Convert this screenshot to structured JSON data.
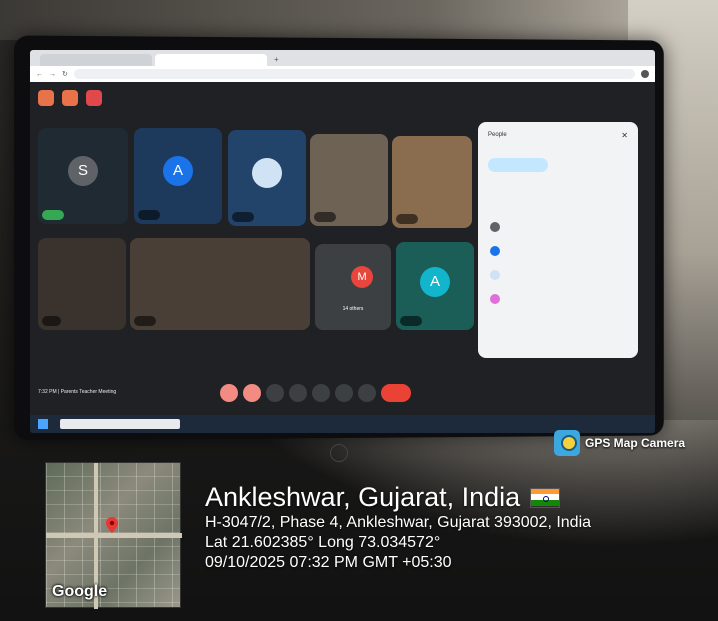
{
  "gps_overlay": {
    "app_name": "GPS Map Camera",
    "location_title": "Ankleshwar, Gujarat, India",
    "address": "H-3047/2, Phase 4, Ankleshwar, Gujarat 393002, India",
    "coordinates": "Lat 21.602385° Long 73.034572°",
    "datetime": "09/10/2025 07:32 PM GMT +05:30",
    "map_brand": "Google",
    "flag_colors": [
      "#FF9933",
      "#FFFFFF",
      "#138808"
    ]
  },
  "screen": {
    "meeting_time": "7:32 PM",
    "meeting_title": "Parents Teacher Meeting",
    "others_label": "14 others",
    "people_panel_title": "People",
    "tiles": [
      {
        "initial": "S",
        "color": "#5f6368"
      },
      {
        "initial": "A",
        "color": "#1a73e8"
      },
      {
        "initial": "M",
        "color": "#e8453c"
      },
      {
        "initial": "A",
        "color": "#12b5cb"
      }
    ]
  }
}
